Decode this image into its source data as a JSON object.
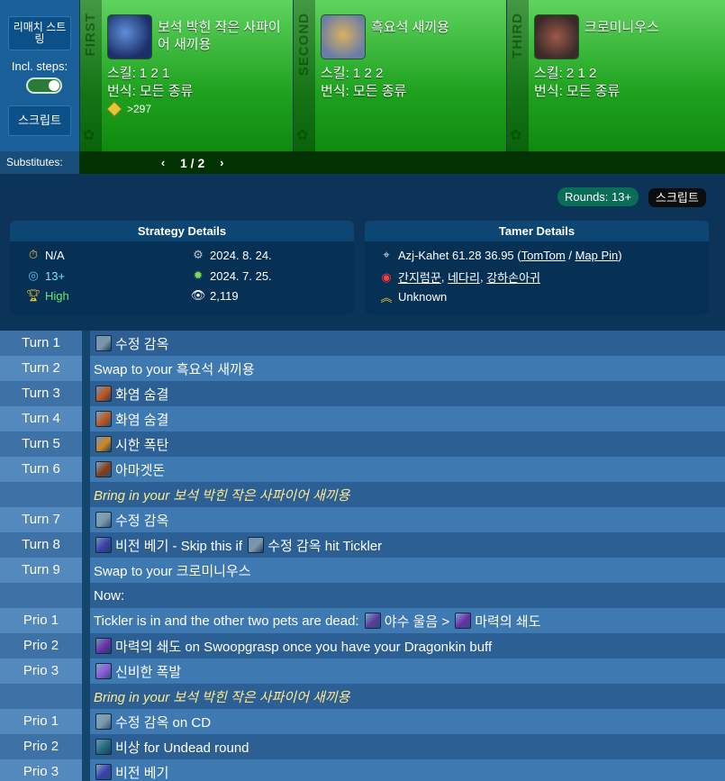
{
  "sidebar": {
    "remix_label": "리매치 스트링",
    "incl_steps_label": "Incl. steps:",
    "script_label": "스크립트",
    "substitutes_label": "Substitutes:"
  },
  "pets": [
    {
      "slot_word": "FIRST",
      "name": "보석 박힌 작은 사파이어 새끼용",
      "skill": "스킬: 1 2 1",
      "breed": "번식: 모든 종류",
      "level_req": ">297"
    },
    {
      "slot_word": "SECOND",
      "name": "흑요석 새끼용",
      "skill": "스킬: 1 2 2",
      "breed": "번식: 모든 종류"
    },
    {
      "slot_word": "THIRD",
      "name": "크로미니우스",
      "skill": "스킬: 2 1 2",
      "breed": "번식: 모든 종류"
    }
  ],
  "pager": {
    "text": "1 / 2",
    "prev": "‹",
    "next": "›"
  },
  "rounds_badge": "Rounds: 13+",
  "script_badge": "스크립트",
  "strategy_details": {
    "title": "Strategy Details",
    "duration": "N/A",
    "rounds": "13+",
    "rating": "High",
    "updated": "2024. 8. 24.",
    "created": "2024. 7. 25.",
    "views": "2,119"
  },
  "tamer_details": {
    "title": "Tamer Details",
    "location": "Azj-Kahet 61.28 36.95 (",
    "tomtom": "TomTom",
    "slash": " / ",
    "mappin": "Map Pin",
    "close": ")",
    "pet1": "간지럼꾼",
    "comma1": ", ",
    "pet2": "네다리",
    "comma2": ", ",
    "pet3": "강하손아귀",
    "level": "Unknown"
  },
  "turns": [
    {
      "label": "Turn 1",
      "style": "dark",
      "parts": [
        {
          "icon": "#7a98a8"
        },
        {
          "text": "수정 감옥"
        }
      ]
    },
    {
      "label": "Turn 2",
      "style": "light",
      "parts": [
        {
          "text": "Swap to your 흑요석 새끼용"
        }
      ]
    },
    {
      "label": "Turn 3",
      "style": "dark",
      "parts": [
        {
          "icon": "#c2541a"
        },
        {
          "text": "화염 숨결"
        }
      ]
    },
    {
      "label": "Turn 4",
      "style": "light",
      "parts": [
        {
          "icon": "#c2541a"
        },
        {
          "text": "화염 숨결"
        }
      ]
    },
    {
      "label": "Turn 5",
      "style": "dark",
      "parts": [
        {
          "icon": "#d0861e"
        },
        {
          "text": "시한 폭탄"
        }
      ]
    },
    {
      "label": "Turn 6",
      "style": "light",
      "parts": [
        {
          "icon": "#8a3a10"
        },
        {
          "text": "아마겟돈"
        }
      ]
    },
    {
      "label": "",
      "style": "dark info",
      "parts": [
        {
          "text": "Bring in your 보석 박힌 작은 사파이어 새끼용"
        }
      ]
    },
    {
      "label": "Turn 7",
      "style": "light",
      "parts": [
        {
          "icon": "#7a98a8"
        },
        {
          "text": "수정 감옥"
        }
      ]
    },
    {
      "label": "Turn 8",
      "style": "dark",
      "parts": [
        {
          "icon": "#3b3fa8"
        },
        {
          "text": "비전 베기 - Skip this if "
        },
        {
          "icon": "#7a98a8"
        },
        {
          "text": "수정 감옥 hit Tickler"
        }
      ]
    },
    {
      "label": "Turn 9",
      "style": "light",
      "parts": [
        {
          "text": "Swap to your 크로미니우스"
        }
      ]
    },
    {
      "label": "",
      "style": "dark",
      "parts": [
        {
          "text": "Now:"
        }
      ]
    },
    {
      "label": "Prio 1",
      "style": "light",
      "parts": [
        {
          "text": "Tickler is in and the other two pets are dead: "
        },
        {
          "icon": "#5a3a9a"
        },
        {
          "text": "야수 울음 > "
        },
        {
          "icon": "#6a2ea8"
        },
        {
          "text": "마력의 쇄도"
        }
      ]
    },
    {
      "label": "Prio 2",
      "style": "dark",
      "parts": [
        {
          "icon": "#6a2ea8"
        },
        {
          "text": "마력의 쇄도 on Swoopgrasp once you have your Dragonkin buff"
        }
      ]
    },
    {
      "label": "Prio 3",
      "style": "light",
      "parts": [
        {
          "icon": "#8a5ad8"
        },
        {
          "text": "신비한 폭발"
        }
      ]
    },
    {
      "label": "",
      "style": "dark info",
      "parts": [
        {
          "text": "Bring in your 보석 박힌 작은 사파이어 새끼용"
        }
      ]
    },
    {
      "label": "Prio 1",
      "style": "light",
      "parts": [
        {
          "icon": "#7a98a8"
        },
        {
          "text": "수정 감옥 on CD"
        }
      ]
    },
    {
      "label": "Prio 2",
      "style": "dark",
      "parts": [
        {
          "icon": "#1e6a7a"
        },
        {
          "text": "비상 for Undead round"
        }
      ]
    },
    {
      "label": "Prio 3",
      "style": "light",
      "parts": [
        {
          "icon": "#3b3fa8"
        },
        {
          "text": "비전 베기"
        }
      ]
    }
  ]
}
